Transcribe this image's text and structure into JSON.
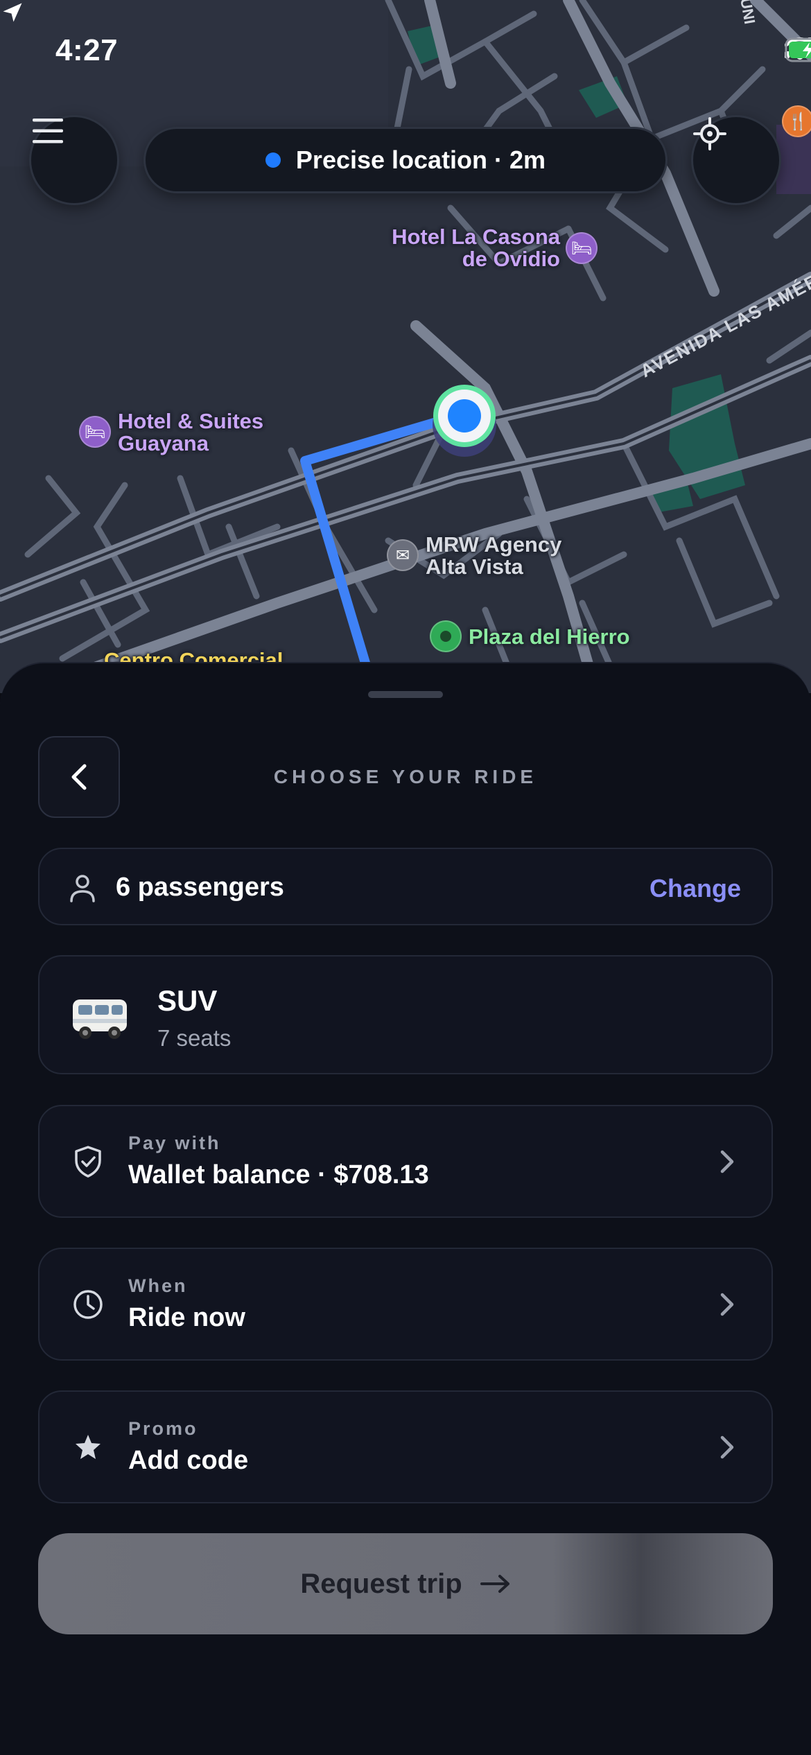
{
  "status_bar": {
    "time": "4:27"
  },
  "map": {
    "location_pill": "Precise location · 2m",
    "street_label": "AVENIDA LAS AMÉRIC",
    "street_label_top": "UNI",
    "pois": {
      "hotel_casona_line1": "Hotel La Casona",
      "hotel_casona_line2": "de Ovidio",
      "hotel_suites_line1": "Hotel & Suites",
      "hotel_suites_line2": "Guayana",
      "mrw_line1": "MRW Agency",
      "mrw_line2": "Alta Vista",
      "plaza": "Plaza del Hierro",
      "centro": "Centro Comercial"
    }
  },
  "sheet": {
    "title": "CHOOSE YOUR RIDE",
    "passengers": {
      "text": "6 passengers",
      "action": "Change"
    },
    "ride": {
      "emoji": "🚐",
      "name": "SUV",
      "seats": "7 seats"
    },
    "payment": {
      "label": "Pay with",
      "value": "Wallet balance · $708.13"
    },
    "when": {
      "label": "When",
      "value": "Ride now"
    },
    "promo": {
      "label": "Promo",
      "value": "Add code"
    },
    "request_label": "Request trip"
  },
  "colors": {
    "accent": "#8b8ff7",
    "route": "#3f82f7",
    "location_dot": "#1f7bff",
    "pin_ring": "#5fe3a1"
  },
  "icons": [
    "menu-icon",
    "location-arrow-icon",
    "signal-icon",
    "wifi-icon",
    "battery-icon",
    "recenter-icon",
    "back-chevron-icon",
    "person-icon",
    "shield-check-icon",
    "clock-icon",
    "star-icon",
    "chevron-right-icon",
    "arrow-right-icon"
  ]
}
